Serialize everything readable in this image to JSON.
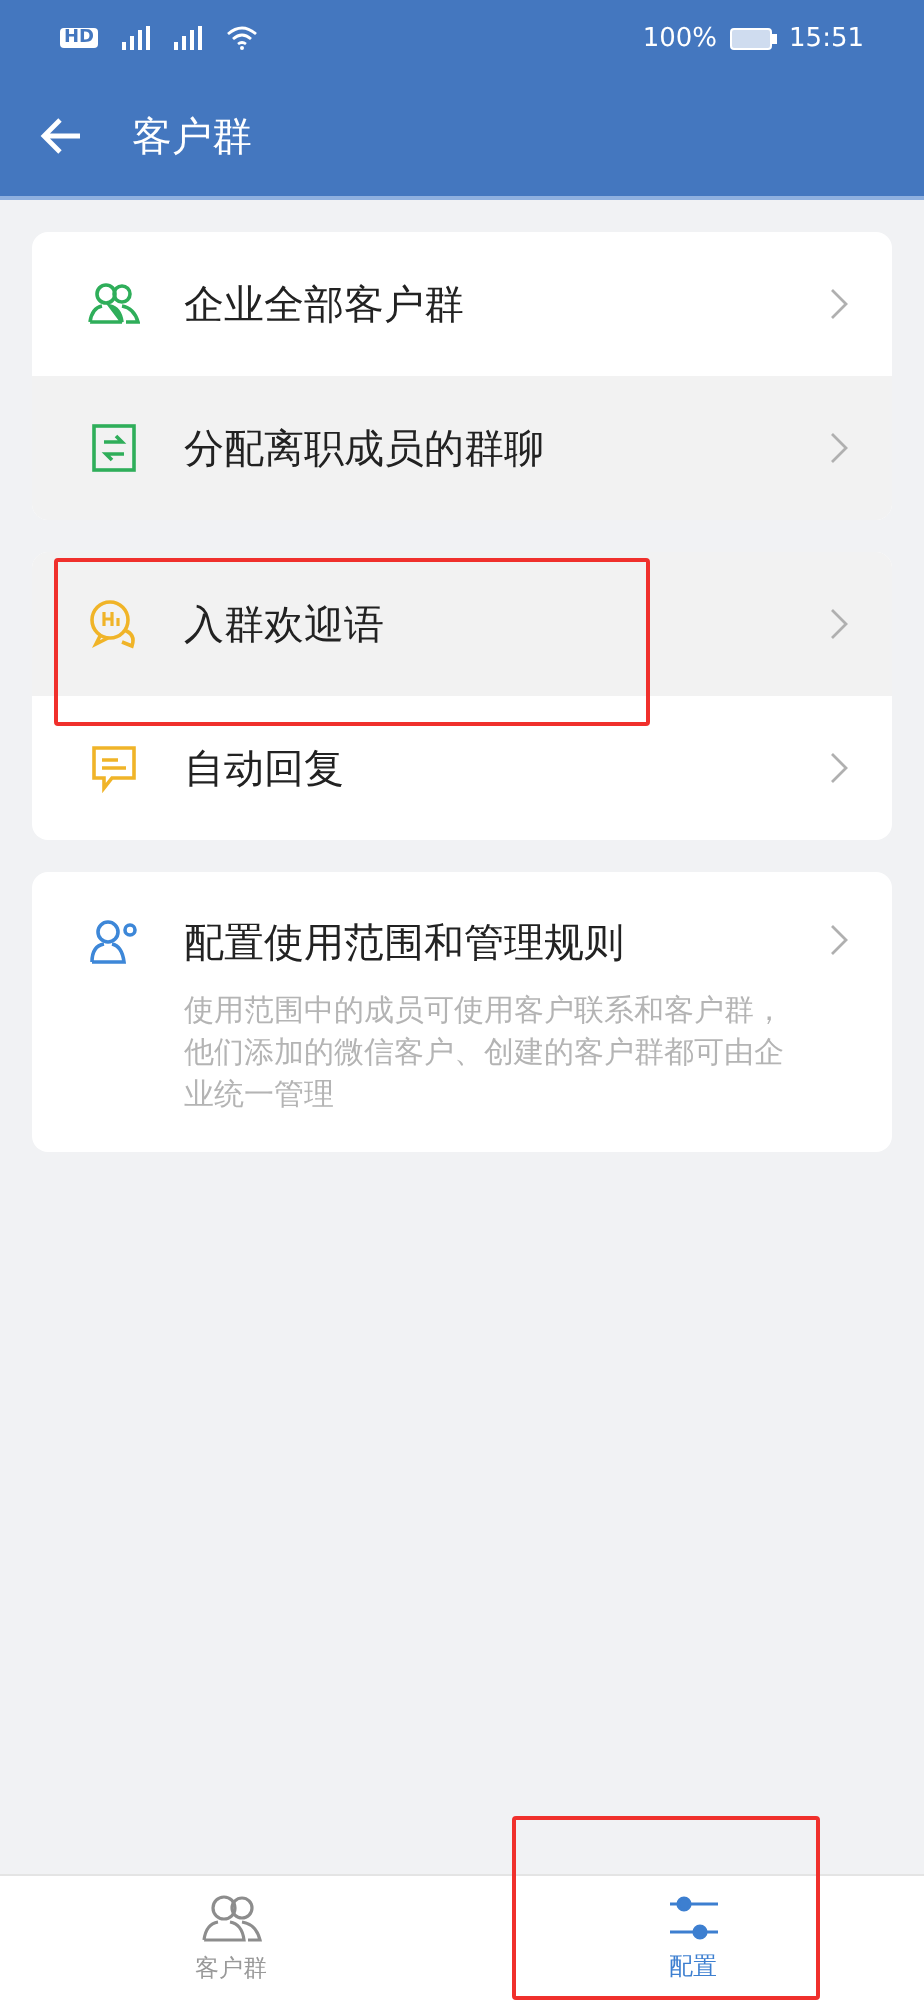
{
  "status_bar": {
    "network": "HD",
    "battery": "100%",
    "time": "15:51"
  },
  "header": {
    "title": "客户群"
  },
  "groups": [
    {
      "items": [
        {
          "kind": "people",
          "label": "企业全部客户群",
          "pressed": false,
          "annotated": false
        },
        {
          "kind": "transfer",
          "label": "分配离职成员的群聊",
          "pressed": true,
          "annotated": false
        }
      ]
    },
    {
      "items": [
        {
          "kind": "hi",
          "label": "入群欢迎语",
          "pressed": true,
          "annotated": true
        },
        {
          "kind": "chat",
          "label": "自动回复",
          "pressed": false,
          "annotated": false
        }
      ]
    },
    {
      "items": [
        {
          "kind": "admin",
          "label": "配置使用范围和管理规则",
          "description": "使用范围中的成员可使用客户联系和客户群，他们添加的微信客户、创建的客户群都可由企业统一管理",
          "pressed": false,
          "annotated": false
        }
      ]
    }
  ],
  "tabs": [
    {
      "kind": "people",
      "label": "客户群",
      "selected": false,
      "annotated": false
    },
    {
      "kind": "sliders",
      "label": "配置",
      "selected": true,
      "annotated": true
    }
  ]
}
